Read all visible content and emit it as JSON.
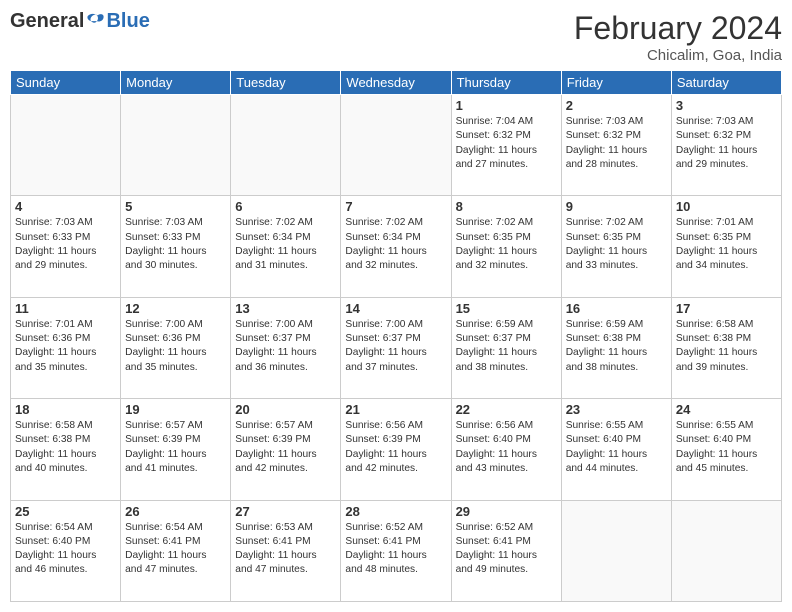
{
  "header": {
    "logo_general": "General",
    "logo_blue": "Blue",
    "month_year": "February 2024",
    "location": "Chicalim, Goa, India"
  },
  "weekdays": [
    "Sunday",
    "Monday",
    "Tuesday",
    "Wednesday",
    "Thursday",
    "Friday",
    "Saturday"
  ],
  "weeks": [
    [
      {
        "day": "",
        "info": ""
      },
      {
        "day": "",
        "info": ""
      },
      {
        "day": "",
        "info": ""
      },
      {
        "day": "",
        "info": ""
      },
      {
        "day": "1",
        "info": "Sunrise: 7:04 AM\nSunset: 6:32 PM\nDaylight: 11 hours\nand 27 minutes."
      },
      {
        "day": "2",
        "info": "Sunrise: 7:03 AM\nSunset: 6:32 PM\nDaylight: 11 hours\nand 28 minutes."
      },
      {
        "day": "3",
        "info": "Sunrise: 7:03 AM\nSunset: 6:32 PM\nDaylight: 11 hours\nand 29 minutes."
      }
    ],
    [
      {
        "day": "4",
        "info": "Sunrise: 7:03 AM\nSunset: 6:33 PM\nDaylight: 11 hours\nand 29 minutes."
      },
      {
        "day": "5",
        "info": "Sunrise: 7:03 AM\nSunset: 6:33 PM\nDaylight: 11 hours\nand 30 minutes."
      },
      {
        "day": "6",
        "info": "Sunrise: 7:02 AM\nSunset: 6:34 PM\nDaylight: 11 hours\nand 31 minutes."
      },
      {
        "day": "7",
        "info": "Sunrise: 7:02 AM\nSunset: 6:34 PM\nDaylight: 11 hours\nand 32 minutes."
      },
      {
        "day": "8",
        "info": "Sunrise: 7:02 AM\nSunset: 6:35 PM\nDaylight: 11 hours\nand 32 minutes."
      },
      {
        "day": "9",
        "info": "Sunrise: 7:02 AM\nSunset: 6:35 PM\nDaylight: 11 hours\nand 33 minutes."
      },
      {
        "day": "10",
        "info": "Sunrise: 7:01 AM\nSunset: 6:35 PM\nDaylight: 11 hours\nand 34 minutes."
      }
    ],
    [
      {
        "day": "11",
        "info": "Sunrise: 7:01 AM\nSunset: 6:36 PM\nDaylight: 11 hours\nand 35 minutes."
      },
      {
        "day": "12",
        "info": "Sunrise: 7:00 AM\nSunset: 6:36 PM\nDaylight: 11 hours\nand 35 minutes."
      },
      {
        "day": "13",
        "info": "Sunrise: 7:00 AM\nSunset: 6:37 PM\nDaylight: 11 hours\nand 36 minutes."
      },
      {
        "day": "14",
        "info": "Sunrise: 7:00 AM\nSunset: 6:37 PM\nDaylight: 11 hours\nand 37 minutes."
      },
      {
        "day": "15",
        "info": "Sunrise: 6:59 AM\nSunset: 6:37 PM\nDaylight: 11 hours\nand 38 minutes."
      },
      {
        "day": "16",
        "info": "Sunrise: 6:59 AM\nSunset: 6:38 PM\nDaylight: 11 hours\nand 38 minutes."
      },
      {
        "day": "17",
        "info": "Sunrise: 6:58 AM\nSunset: 6:38 PM\nDaylight: 11 hours\nand 39 minutes."
      }
    ],
    [
      {
        "day": "18",
        "info": "Sunrise: 6:58 AM\nSunset: 6:38 PM\nDaylight: 11 hours\nand 40 minutes."
      },
      {
        "day": "19",
        "info": "Sunrise: 6:57 AM\nSunset: 6:39 PM\nDaylight: 11 hours\nand 41 minutes."
      },
      {
        "day": "20",
        "info": "Sunrise: 6:57 AM\nSunset: 6:39 PM\nDaylight: 11 hours\nand 42 minutes."
      },
      {
        "day": "21",
        "info": "Sunrise: 6:56 AM\nSunset: 6:39 PM\nDaylight: 11 hours\nand 42 minutes."
      },
      {
        "day": "22",
        "info": "Sunrise: 6:56 AM\nSunset: 6:40 PM\nDaylight: 11 hours\nand 43 minutes."
      },
      {
        "day": "23",
        "info": "Sunrise: 6:55 AM\nSunset: 6:40 PM\nDaylight: 11 hours\nand 44 minutes."
      },
      {
        "day": "24",
        "info": "Sunrise: 6:55 AM\nSunset: 6:40 PM\nDaylight: 11 hours\nand 45 minutes."
      }
    ],
    [
      {
        "day": "25",
        "info": "Sunrise: 6:54 AM\nSunset: 6:40 PM\nDaylight: 11 hours\nand 46 minutes."
      },
      {
        "day": "26",
        "info": "Sunrise: 6:54 AM\nSunset: 6:41 PM\nDaylight: 11 hours\nand 47 minutes."
      },
      {
        "day": "27",
        "info": "Sunrise: 6:53 AM\nSunset: 6:41 PM\nDaylight: 11 hours\nand 47 minutes."
      },
      {
        "day": "28",
        "info": "Sunrise: 6:52 AM\nSunset: 6:41 PM\nDaylight: 11 hours\nand 48 minutes."
      },
      {
        "day": "29",
        "info": "Sunrise: 6:52 AM\nSunset: 6:41 PM\nDaylight: 11 hours\nand 49 minutes."
      },
      {
        "day": "",
        "info": ""
      },
      {
        "day": "",
        "info": ""
      }
    ]
  ]
}
